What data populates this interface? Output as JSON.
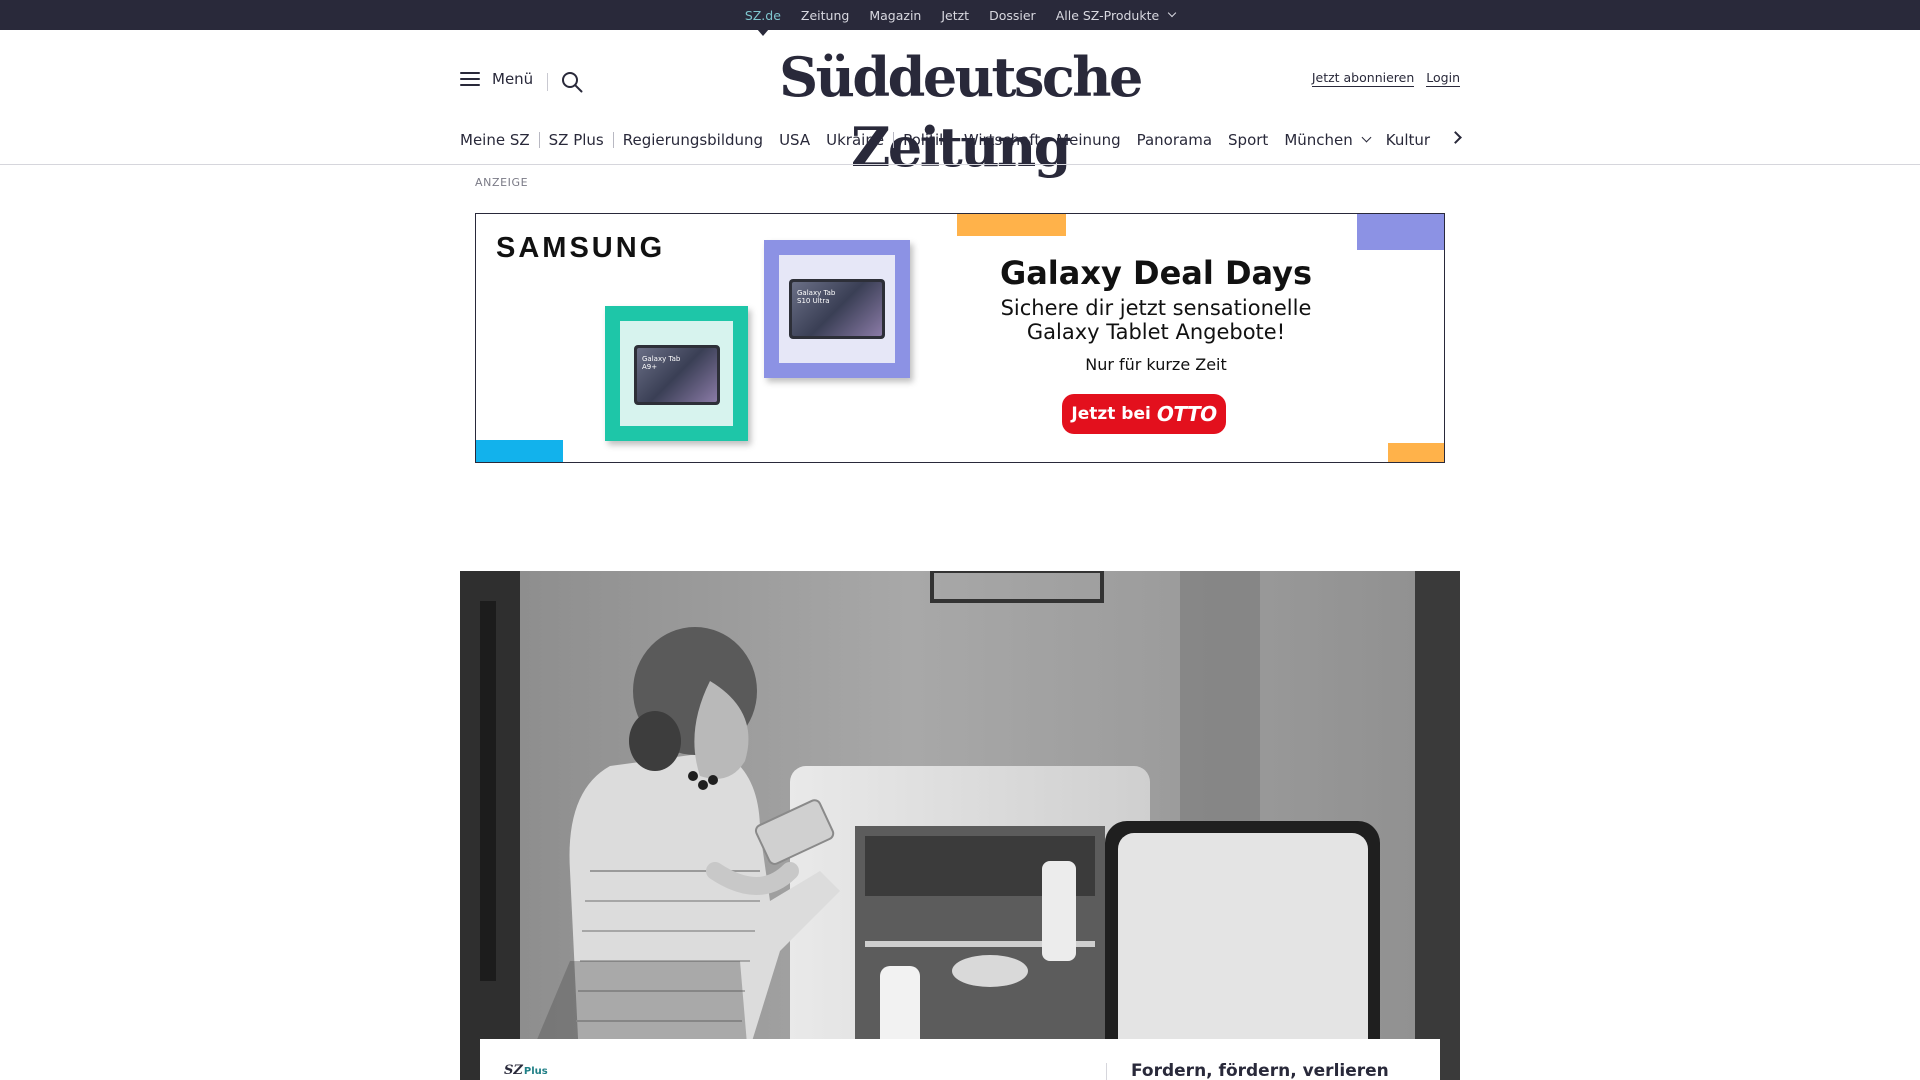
{
  "topbar": {
    "items": [
      {
        "label": "SZ.de",
        "active": true
      },
      {
        "label": "Zeitung"
      },
      {
        "label": "Magazin"
      },
      {
        "label": "Jetzt"
      },
      {
        "label": "Dossier"
      },
      {
        "label": "Alle SZ-Produkte",
        "has_dropdown": true
      }
    ],
    "background": "#29293a",
    "active_color": "#7fc6cf"
  },
  "header": {
    "menu_label": "Menü",
    "menu_icon": "hamburger-icon",
    "search_icon": "search-icon",
    "logo_text": "Süddeutsche Zeitung",
    "subscribe_label": "Jetzt abonnieren",
    "login_label": "Login"
  },
  "section_nav": {
    "items": [
      {
        "label": "Meine SZ"
      },
      {
        "label": "SZ Plus"
      },
      {
        "label": "Regierungsbildung"
      },
      {
        "label": "USA"
      },
      {
        "label": "Ukraine"
      },
      {
        "label": "Politik"
      },
      {
        "label": "Wirtschaft"
      },
      {
        "label": "Meinung"
      },
      {
        "label": "Panorama"
      },
      {
        "label": "Sport"
      },
      {
        "label": "München",
        "has_dropdown": true
      },
      {
        "label": "Kultur"
      }
    ],
    "next_icon": "chevron-right-icon"
  },
  "ad": {
    "label": "ANZEIGE",
    "brand": "SAMSUNG",
    "title": "Galaxy Deal Days",
    "subtitle_line1": "Sichere dir jetzt sensationelle",
    "subtitle_line2": "Galaxy Tablet Angebote!",
    "small_text": "Nur für kurze Zeit",
    "cta_prefix": "Jetzt bei",
    "cta_brand": "OTTO",
    "tablet_1": "Galaxy Tab A9+",
    "tablet_2": "Galaxy Tab S10 Ultra",
    "colors": {
      "teal": "#1ec6a8",
      "periwinkle": "#8c92e4",
      "orange": "#ffb24a",
      "cyan": "#12b2ec",
      "cta_red": "#e3101d"
    }
  },
  "article": {
    "badge": "SZ",
    "badge_suffix": "Plus",
    "side_headline": "Fordern, fördern, verlieren"
  }
}
